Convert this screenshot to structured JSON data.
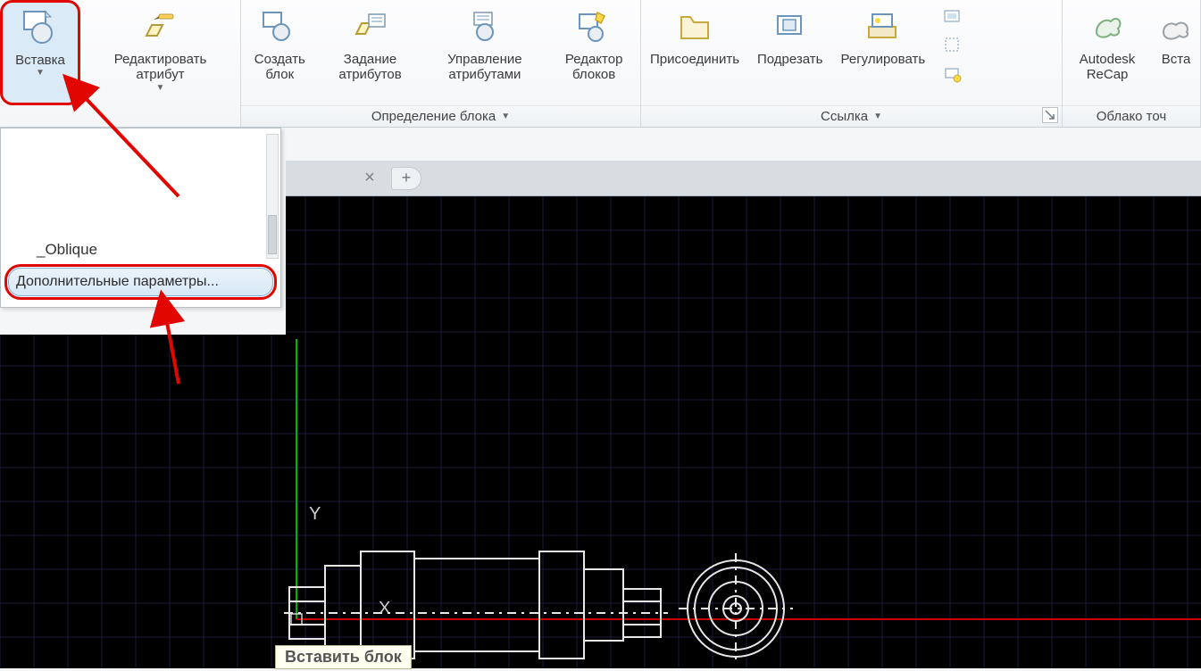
{
  "ribbon": {
    "insert_label": "Вставка",
    "editattr_label": "Редактировать атрибут",
    "createblock_label": "Создать блок",
    "defattr_label": "Задание атрибутов",
    "manageattr_label": "Управление атрибутами",
    "blockeditor_label": "Редактор блоков",
    "panel_blockdef_title": "Определение блока",
    "attach_label": "Присоединить",
    "clip_label": "Подрезать",
    "adjust_label": "Регулировать",
    "panel_ref_title": "Ссылка",
    "recap_label": "Autodesk ReCap",
    "vsta_label": "Вста",
    "panel_cloud_title": "Облако точ"
  },
  "dropdown": {
    "preview_label": "_Oblique",
    "more_options": "Дополнительные параметры..."
  },
  "tooltip": {
    "title": "Вставить блок"
  },
  "axis": {
    "x": "X",
    "y": "Y"
  },
  "tabs": {
    "close": "×",
    "plus": "+"
  }
}
